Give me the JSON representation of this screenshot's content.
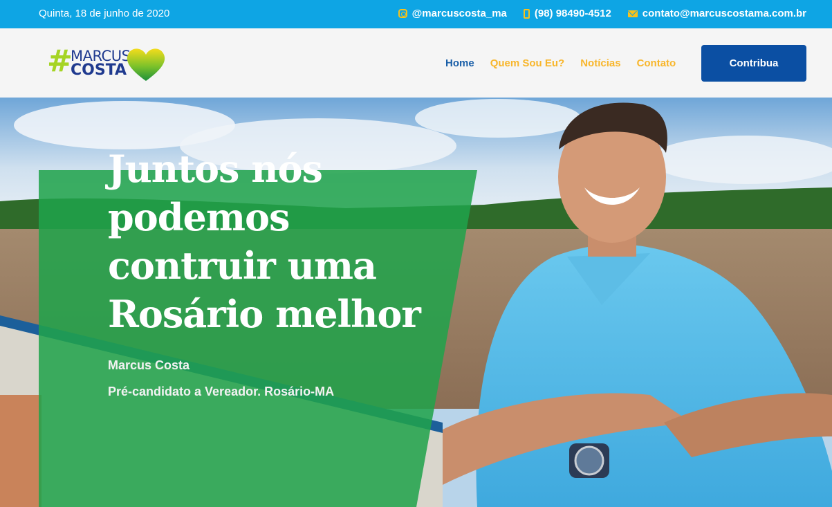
{
  "topbar": {
    "date": "Quinta, 18 de junho de 2020",
    "instagram": "@marcuscosta_ma",
    "phone": "(98) 98490-4512",
    "email": "contato@marcuscostama.com.br",
    "icons": [
      "instagram-icon",
      "phone-icon",
      "mail-icon"
    ],
    "bg_color": "#0ea5e4",
    "icon_color": "#f8c21b"
  },
  "logo": {
    "hash": "#",
    "line1": "MARCUS",
    "line2": "COSTA"
  },
  "nav": {
    "items": [
      "Home",
      "Quem Sou Eu?",
      "Notícias",
      "Contato"
    ],
    "active_color": "#1a5fa8",
    "color": "#f8b62b"
  },
  "cta": {
    "label": "Contribua",
    "color": "#0b4fa3"
  },
  "hero": {
    "title": "Juntos nós podemos contruir uma Rosário melhor",
    "name": "Marcus Costa",
    "role": "Pré-candidato a Vereador. Rosário-MA",
    "panel_color": "#1fa34a"
  }
}
